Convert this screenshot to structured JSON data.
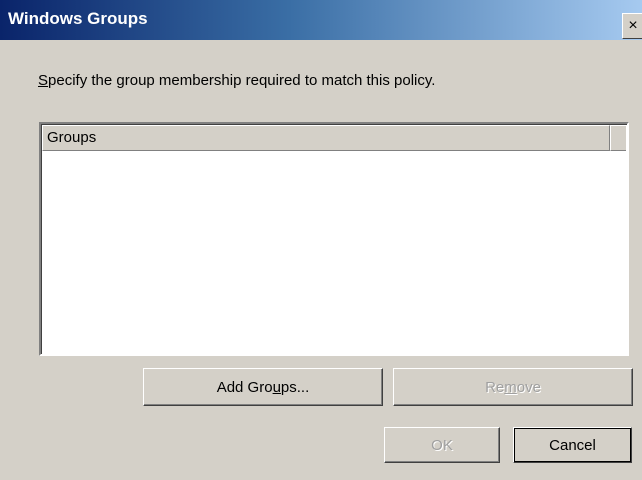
{
  "window": {
    "title": "Windows Groups",
    "close_glyph": "×",
    "close_icon": "close-icon"
  },
  "instruction": {
    "pre": "",
    "mnemonic": "S",
    "post": "pecify the group membership required to match this policy."
  },
  "groups_list": {
    "column_header": "Groups",
    "rows": []
  },
  "buttons": {
    "add_groups": {
      "pre": "Add Gro",
      "mnemonic": "u",
      "post": "ps...",
      "enabled": true
    },
    "remove": {
      "pre": "Re",
      "mnemonic": "m",
      "post": "ove",
      "enabled": false
    },
    "ok": {
      "label": "OK",
      "enabled": false
    },
    "cancel": {
      "label": "Cancel",
      "enabled": true
    }
  },
  "colors": {
    "face": "#d4d0c8",
    "title_start": "#0a246a",
    "title_end": "#a6caf0",
    "disabled_text": "#a0a0a0"
  }
}
